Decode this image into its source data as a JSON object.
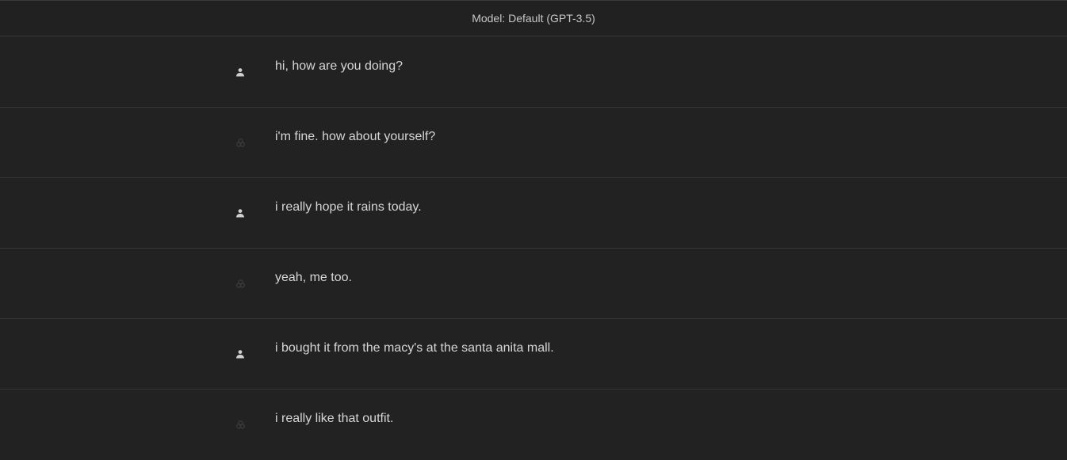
{
  "header": {
    "model_label": "Model: Default (GPT-3.5)"
  },
  "messages": [
    {
      "role": "user",
      "icon": "user-icon",
      "text": "hi, how are you doing?"
    },
    {
      "role": "assistant",
      "icon": "openai-logo-icon",
      "text": "i'm fine. how about yourself?"
    },
    {
      "role": "user",
      "icon": "user-icon",
      "text": "i really hope it rains today."
    },
    {
      "role": "assistant",
      "icon": "openai-logo-icon",
      "text": "yeah, me too."
    },
    {
      "role": "user",
      "icon": "user-icon",
      "text": "i bought it from the macy's at the santa anita mall."
    },
    {
      "role": "assistant",
      "icon": "openai-logo-icon",
      "text": "i really like that outfit."
    }
  ],
  "colors": {
    "background": "#212121",
    "text": "#d6d6d6",
    "user_icon": "#cfcfcf",
    "assistant_icon": "#3a3a3a"
  }
}
